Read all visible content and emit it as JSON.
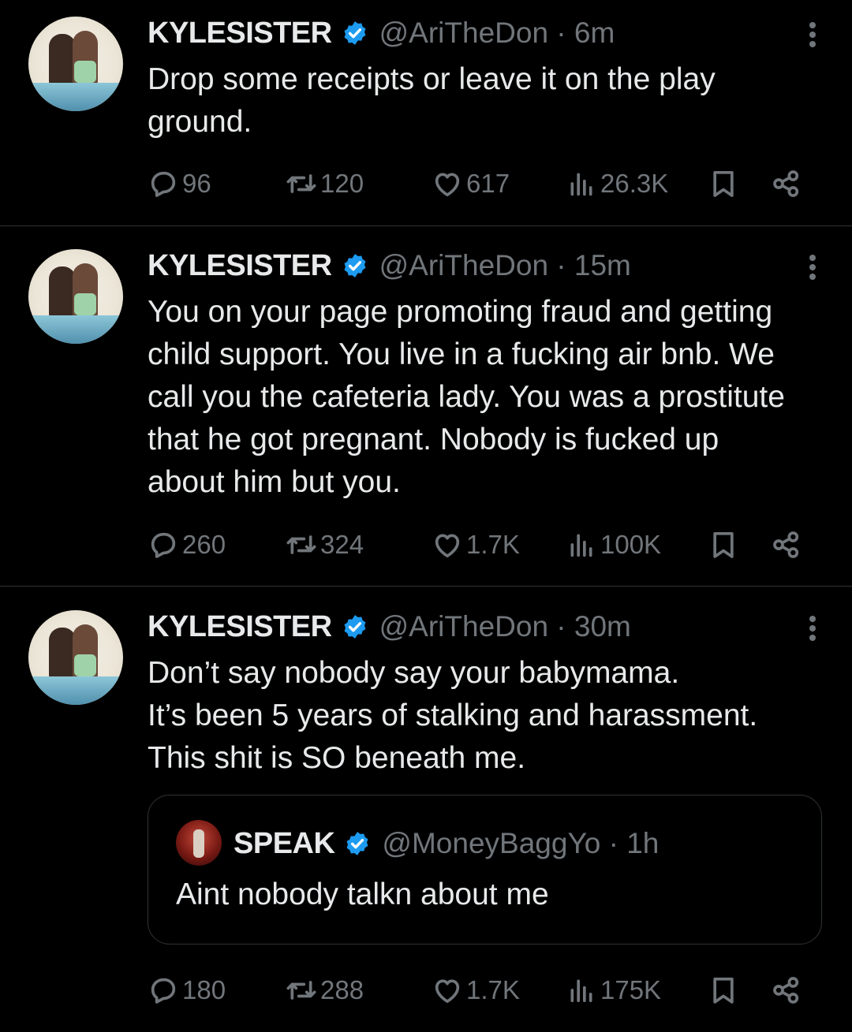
{
  "tweets": [
    {
      "name": "KYLESISTER",
      "handle_time": "@AriTheDon · 6m",
      "text": "Drop some receipts or leave it on the play\nground.",
      "replies": "96",
      "reposts": "120",
      "likes": "617",
      "views": "26.3K"
    },
    {
      "name": "KYLESISTER",
      "handle_time": "@AriTheDon · 15m",
      "text": "You on your page promoting fraud and getting\nchild support. You live in a fucking air bnb. We\ncall you the cafeteria lady. You was a prostitute\nthat he got pregnant. Nobody is fucked up\nabout him but you.",
      "replies": "260",
      "reposts": "324",
      "likes": "1.7K",
      "views": "100K"
    },
    {
      "name": "KYLESISTER",
      "handle_time": "@AriTheDon · 30m",
      "text": "Don’t say nobody say your babymama.\nIt’s been 5 years of stalking and harassment.\nThis shit is SO beneath me.",
      "replies": "180",
      "reposts": "288",
      "likes": "1.7K",
      "views": "175K",
      "quote": {
        "name": "SPEAK",
        "handle_time": "@MoneyBaggYo · 1h",
        "text": "Aint nobody talkn about me"
      }
    }
  ],
  "colors": {
    "background": "#000000",
    "text": "#e7e9ea",
    "muted": "#71767b",
    "verified": "#1d9bf0",
    "divider": "#2f3336"
  }
}
